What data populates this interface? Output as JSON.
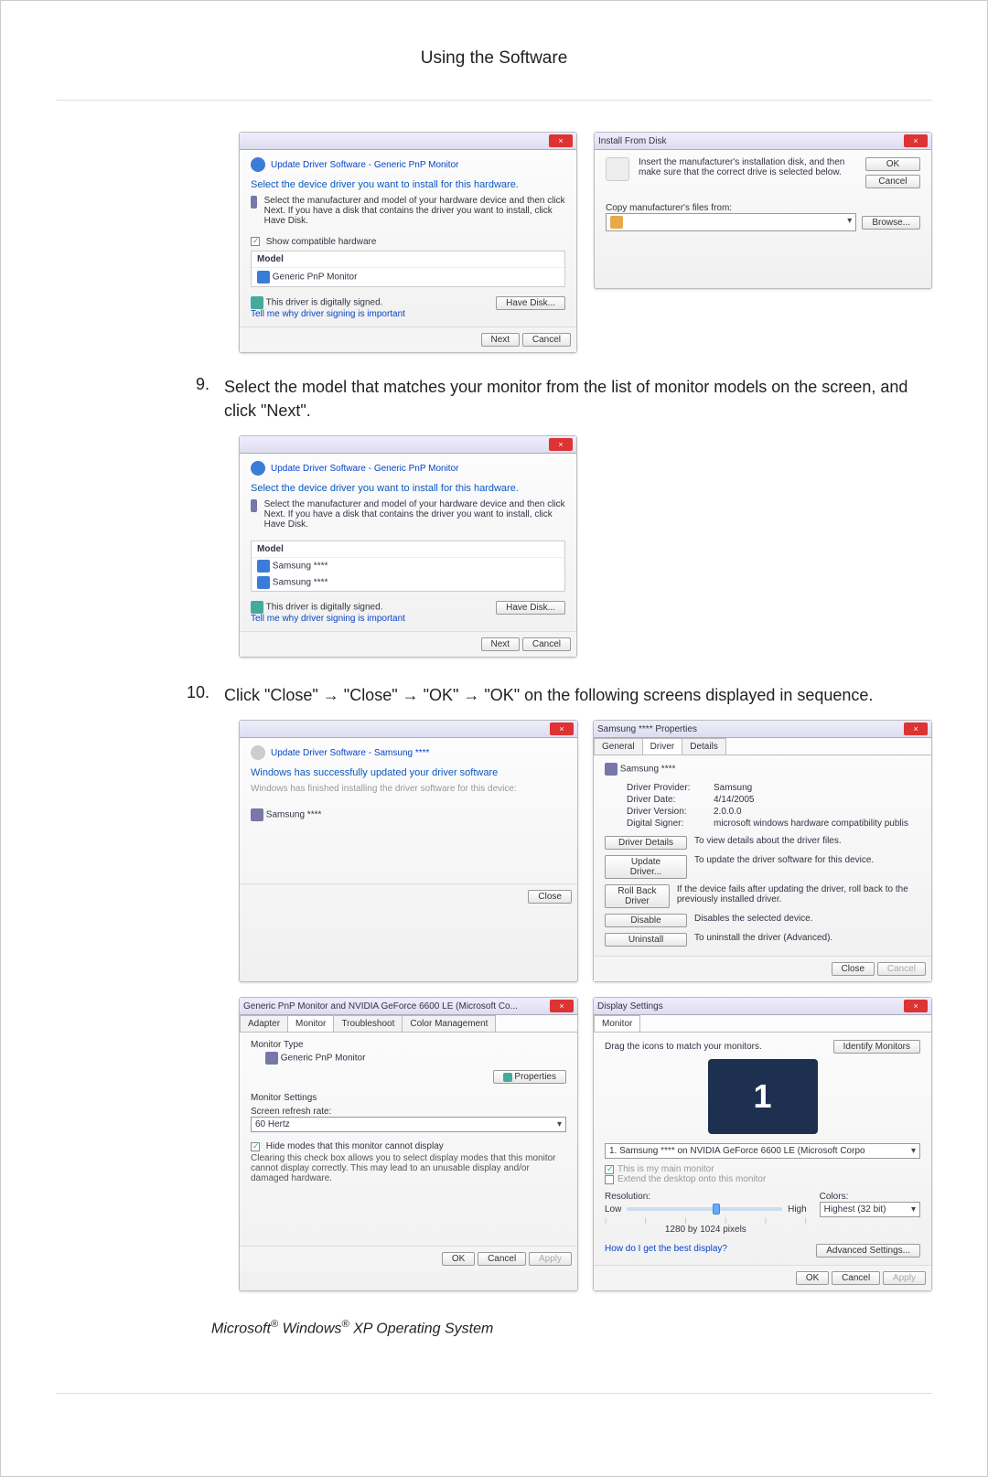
{
  "page": {
    "title": "Using the Software",
    "step9_num": "9.",
    "step9_text": "Select the model that matches your monitor from the list of monitor models on the screen, and click \"Next\".",
    "step10_num": "10.",
    "step10_text": "Click \"Close\" → \"Close\" → \"OK\" → \"OK\" on the following screens displayed in sequence.",
    "footnote_prefix": "Microsoft",
    "footnote_mid": " Windows",
    "footnote_suffix": " XP Operating System"
  },
  "wizard1": {
    "breadcrumb": "Update Driver Software - Generic PnP Monitor",
    "head": "Select the device driver you want to install for this hardware.",
    "body": "Select the manufacturer and model of your hardware device and then click Next. If you have a disk that contains the driver you want to install, click Have Disk.",
    "show_compat_chk": "Show compatible hardware",
    "model_hdr": "Model",
    "model1": "Generic PnP Monitor",
    "signed": "This driver is digitally signed.",
    "tell": "Tell me why driver signing is important",
    "have_disk": "Have Disk...",
    "next": "Next",
    "cancel": "Cancel"
  },
  "install_from_disk": {
    "title": "Install From Disk",
    "msg": "Insert the manufacturer's installation disk, and then make sure that the correct drive is selected below.",
    "ok": "OK",
    "cancel": "Cancel",
    "copy_label": "Copy manufacturer's files from:",
    "browse": "Browse..."
  },
  "wizard2": {
    "breadcrumb": "Update Driver Software - Generic PnP Monitor",
    "head": "Select the device driver you want to install for this hardware.",
    "body": "Select the manufacturer and model of your hardware device and then click Next. If you have a disk that contains the driver you want to install, click Have Disk.",
    "model_hdr": "Model",
    "m1": "Samsung ****",
    "m2": "Samsung ****",
    "signed": "This driver is digitally signed.",
    "tell": "Tell me why driver signing is important",
    "have_disk": "Have Disk...",
    "next": "Next",
    "cancel": "Cancel"
  },
  "done": {
    "breadcrumb": "Update Driver Software - Samsung ****",
    "head": "Windows has successfully updated your driver software",
    "sub": "Windows has finished installing the driver software for this device:",
    "device": "Samsung ****",
    "close": "Close"
  },
  "props": {
    "title": "Samsung **** Properties",
    "tab_general": "General",
    "tab_driver": "Driver",
    "tab_details": "Details",
    "device": "Samsung ****",
    "kv": {
      "provider_k": "Driver Provider:",
      "provider_v": "Samsung",
      "date_k": "Driver Date:",
      "date_v": "4/14/2005",
      "version_k": "Driver Version:",
      "version_v": "2.0.0.0",
      "signer_k": "Digital Signer:",
      "signer_v": "microsoft windows hardware compatibility publis"
    },
    "btn_details": "Driver Details",
    "btn_details_t": "To view details about the driver files.",
    "btn_update": "Update Driver...",
    "btn_update_t": "To update the driver software for this device.",
    "btn_roll": "Roll Back Driver",
    "btn_roll_t": "If the device fails after updating the driver, roll back to the previously installed driver.",
    "btn_disable": "Disable",
    "btn_disable_t": "Disables the selected device.",
    "btn_uninst": "Uninstall",
    "btn_uninst_t": "To uninstall the driver (Advanced).",
    "close": "Close",
    "cancel": "Cancel"
  },
  "mon_adapter": {
    "title": "Generic PnP Monitor and NVIDIA GeForce 6600 LE (Microsoft Co...",
    "tab_adapter": "Adapter",
    "tab_monitor": "Monitor",
    "tab_trouble": "Troubleshoot",
    "tab_color": "Color Management",
    "type_hdr": "Monitor Type",
    "type_val": "Generic PnP Monitor",
    "properties": "Properties",
    "settings_hdr": "Monitor Settings",
    "refresh_lbl": "Screen refresh rate:",
    "refresh_val": "60 Hertz",
    "hide_chk": "Hide modes that this monitor cannot display",
    "hide_msg": "Clearing this check box allows you to select display modes that this monitor cannot display correctly. This may lead to an unusable display and/or damaged hardware.",
    "ok": "OK",
    "cancel": "Cancel",
    "apply": "Apply"
  },
  "display_settings": {
    "title": "Display Settings",
    "tab_monitor": "Monitor",
    "drag": "Drag the icons to match your monitors.",
    "identify": "Identify Monitors",
    "mon_num": "1",
    "select_val": "1. Samsung **** on NVIDIA GeForce 6600 LE (Microsoft Corpo",
    "chk_main": "This is my main monitor",
    "chk_extend": "Extend the desktop onto this monitor",
    "res_lbl": "Resolution:",
    "low": "Low",
    "high": "High",
    "res_val": "1280 by 1024 pixels",
    "color_lbl": "Colors:",
    "color_val": "Highest (32 bit)",
    "best": "How do I get the best display?",
    "adv": "Advanced Settings...",
    "ok": "OK",
    "cancel": "Cancel",
    "apply": "Apply"
  }
}
